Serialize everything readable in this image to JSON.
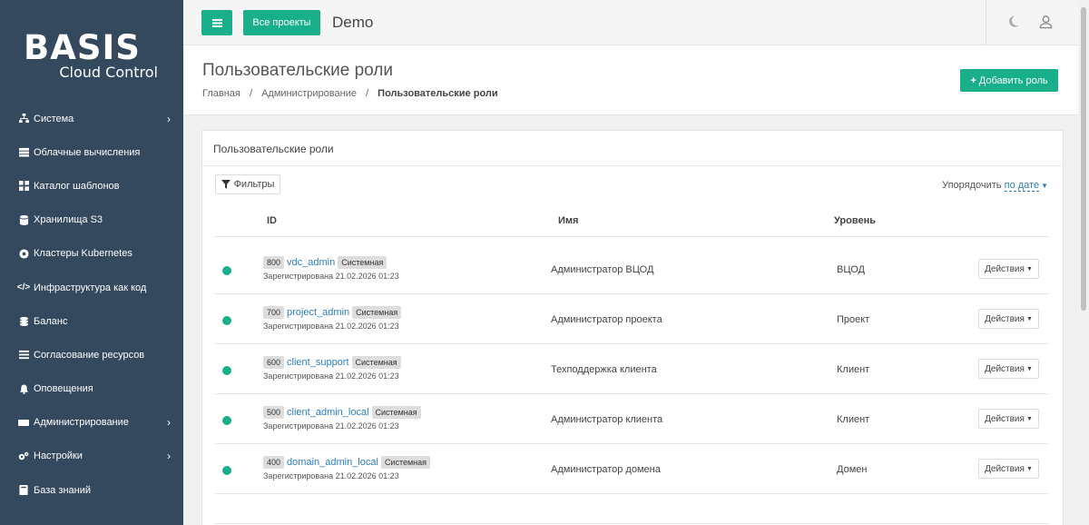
{
  "brand": {
    "logo_word": "BASIS",
    "logo_sub": "Cloud Control"
  },
  "sidebar": {
    "items": [
      {
        "label": "Система",
        "icon": "sitemap-icon",
        "has_submenu": true
      },
      {
        "label": "Облачные вычисления",
        "icon": "server-icon",
        "has_submenu": false
      },
      {
        "label": "Каталог шаблонов",
        "icon": "grid-icon",
        "has_submenu": false
      },
      {
        "label": "Хранилища S3",
        "icon": "database-icon",
        "has_submenu": false
      },
      {
        "label": "Кластеры Kubernetes",
        "icon": "kubernetes-icon",
        "has_submenu": false
      },
      {
        "label": "Инфраструктура как код",
        "icon": "code-icon",
        "has_submenu": false
      },
      {
        "label": "Баланс",
        "icon": "coins-icon",
        "has_submenu": false
      },
      {
        "label": "Согласование ресурсов",
        "icon": "list-icon",
        "has_submenu": false
      },
      {
        "label": "Оповещения",
        "icon": "bell-icon",
        "has_submenu": false
      },
      {
        "label": "Администрирование",
        "icon": "admin-icon",
        "has_submenu": true
      },
      {
        "label": "Настройки",
        "icon": "cogs-icon",
        "has_submenu": true
      },
      {
        "label": "База знаний",
        "icon": "book-icon",
        "has_submenu": false
      }
    ]
  },
  "topbar": {
    "projects_label": "Все проекты",
    "project_name": "Demo"
  },
  "page": {
    "title": "Пользовательские роли",
    "breadcrumb": [
      "Главная",
      "Администрирование",
      "Пользовательские роли"
    ],
    "add_label": "Добавить роль"
  },
  "card": {
    "title": "Пользовательские роли",
    "filter_label": "Фильтры",
    "sort_label": "Упорядочить",
    "sort_value": "по дате",
    "columns": [
      "ID",
      "Имя",
      "Уровень"
    ],
    "actions_label": "Действия",
    "rows": [
      {
        "id": "800",
        "role": "vdc_admin",
        "tag": "Системная",
        "registered": "Зарегистрирована 21.02.2026 01:23",
        "name": "Администратор ВЦОД",
        "level": "ВЦОД"
      },
      {
        "id": "700",
        "role": "project_admin",
        "tag": "Системная",
        "registered": "Зарегистрирована 21.02.2026 01:23",
        "name": "Администратор проекта",
        "level": "Проект"
      },
      {
        "id": "600",
        "role": "client_support",
        "tag": "Системная",
        "registered": "Зарегистрирована 21.02.2026 01:23",
        "name": "Техподдержка клиента",
        "level": "Клиент"
      },
      {
        "id": "500",
        "role": "client_admin_local",
        "tag": "Системная",
        "registered": "Зарегистрирована 21.02.2026 01:23",
        "name": "Администратор клиента",
        "level": "Клиент"
      },
      {
        "id": "400",
        "role": "domain_admin_local",
        "tag": "Системная",
        "registered": "Зарегистрирована 21.02.2026 01:23",
        "name": "Администратор домена",
        "level": "Домен"
      }
    ]
  },
  "colors": {
    "sidebar": "#34495e",
    "accent": "#1aaf8b",
    "link": "#2b7fc0"
  }
}
